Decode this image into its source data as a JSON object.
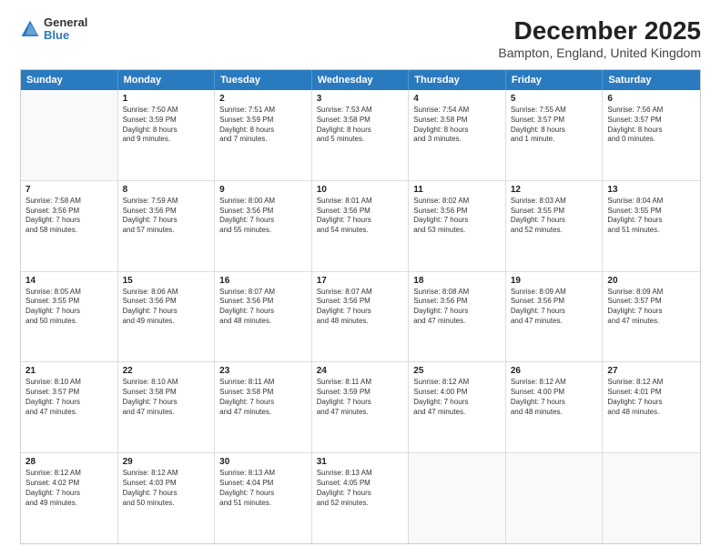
{
  "header": {
    "logo_line1": "General",
    "logo_line2": "Blue",
    "title": "December 2025",
    "subtitle": "Bampton, England, United Kingdom"
  },
  "calendar": {
    "weekdays": [
      "Sunday",
      "Monday",
      "Tuesday",
      "Wednesday",
      "Thursday",
      "Friday",
      "Saturday"
    ],
    "rows": [
      [
        {
          "day": "",
          "text": ""
        },
        {
          "day": "1",
          "text": "Sunrise: 7:50 AM\nSunset: 3:59 PM\nDaylight: 8 hours\nand 9 minutes."
        },
        {
          "day": "2",
          "text": "Sunrise: 7:51 AM\nSunset: 3:59 PM\nDaylight: 8 hours\nand 7 minutes."
        },
        {
          "day": "3",
          "text": "Sunrise: 7:53 AM\nSunset: 3:58 PM\nDaylight: 8 hours\nand 5 minutes."
        },
        {
          "day": "4",
          "text": "Sunrise: 7:54 AM\nSunset: 3:58 PM\nDaylight: 8 hours\nand 3 minutes."
        },
        {
          "day": "5",
          "text": "Sunrise: 7:55 AM\nSunset: 3:57 PM\nDaylight: 8 hours\nand 1 minute."
        },
        {
          "day": "6",
          "text": "Sunrise: 7:56 AM\nSunset: 3:57 PM\nDaylight: 8 hours\nand 0 minutes."
        }
      ],
      [
        {
          "day": "7",
          "text": "Sunrise: 7:58 AM\nSunset: 3:56 PM\nDaylight: 7 hours\nand 58 minutes."
        },
        {
          "day": "8",
          "text": "Sunrise: 7:59 AM\nSunset: 3:56 PM\nDaylight: 7 hours\nand 57 minutes."
        },
        {
          "day": "9",
          "text": "Sunrise: 8:00 AM\nSunset: 3:56 PM\nDaylight: 7 hours\nand 55 minutes."
        },
        {
          "day": "10",
          "text": "Sunrise: 8:01 AM\nSunset: 3:56 PM\nDaylight: 7 hours\nand 54 minutes."
        },
        {
          "day": "11",
          "text": "Sunrise: 8:02 AM\nSunset: 3:56 PM\nDaylight: 7 hours\nand 53 minutes."
        },
        {
          "day": "12",
          "text": "Sunrise: 8:03 AM\nSunset: 3:55 PM\nDaylight: 7 hours\nand 52 minutes."
        },
        {
          "day": "13",
          "text": "Sunrise: 8:04 AM\nSunset: 3:55 PM\nDaylight: 7 hours\nand 51 minutes."
        }
      ],
      [
        {
          "day": "14",
          "text": "Sunrise: 8:05 AM\nSunset: 3:55 PM\nDaylight: 7 hours\nand 50 minutes."
        },
        {
          "day": "15",
          "text": "Sunrise: 8:06 AM\nSunset: 3:56 PM\nDaylight: 7 hours\nand 49 minutes."
        },
        {
          "day": "16",
          "text": "Sunrise: 8:07 AM\nSunset: 3:56 PM\nDaylight: 7 hours\nand 48 minutes."
        },
        {
          "day": "17",
          "text": "Sunrise: 8:07 AM\nSunset: 3:56 PM\nDaylight: 7 hours\nand 48 minutes."
        },
        {
          "day": "18",
          "text": "Sunrise: 8:08 AM\nSunset: 3:56 PM\nDaylight: 7 hours\nand 47 minutes."
        },
        {
          "day": "19",
          "text": "Sunrise: 8:09 AM\nSunset: 3:56 PM\nDaylight: 7 hours\nand 47 minutes."
        },
        {
          "day": "20",
          "text": "Sunrise: 8:09 AM\nSunset: 3:57 PM\nDaylight: 7 hours\nand 47 minutes."
        }
      ],
      [
        {
          "day": "21",
          "text": "Sunrise: 8:10 AM\nSunset: 3:57 PM\nDaylight: 7 hours\nand 47 minutes."
        },
        {
          "day": "22",
          "text": "Sunrise: 8:10 AM\nSunset: 3:58 PM\nDaylight: 7 hours\nand 47 minutes."
        },
        {
          "day": "23",
          "text": "Sunrise: 8:11 AM\nSunset: 3:58 PM\nDaylight: 7 hours\nand 47 minutes."
        },
        {
          "day": "24",
          "text": "Sunrise: 8:11 AM\nSunset: 3:59 PM\nDaylight: 7 hours\nand 47 minutes."
        },
        {
          "day": "25",
          "text": "Sunrise: 8:12 AM\nSunset: 4:00 PM\nDaylight: 7 hours\nand 47 minutes."
        },
        {
          "day": "26",
          "text": "Sunrise: 8:12 AM\nSunset: 4:00 PM\nDaylight: 7 hours\nand 48 minutes."
        },
        {
          "day": "27",
          "text": "Sunrise: 8:12 AM\nSunset: 4:01 PM\nDaylight: 7 hours\nand 48 minutes."
        }
      ],
      [
        {
          "day": "28",
          "text": "Sunrise: 8:12 AM\nSunset: 4:02 PM\nDaylight: 7 hours\nand 49 minutes."
        },
        {
          "day": "29",
          "text": "Sunrise: 8:12 AM\nSunset: 4:03 PM\nDaylight: 7 hours\nand 50 minutes."
        },
        {
          "day": "30",
          "text": "Sunrise: 8:13 AM\nSunset: 4:04 PM\nDaylight: 7 hours\nand 51 minutes."
        },
        {
          "day": "31",
          "text": "Sunrise: 8:13 AM\nSunset: 4:05 PM\nDaylight: 7 hours\nand 52 minutes."
        },
        {
          "day": "",
          "text": ""
        },
        {
          "day": "",
          "text": ""
        },
        {
          "day": "",
          "text": ""
        }
      ]
    ]
  }
}
